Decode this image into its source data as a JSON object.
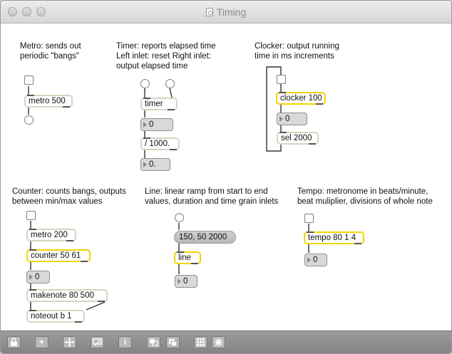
{
  "window": {
    "title": "Timing"
  },
  "comments": {
    "metro": "Metro: sends out\nperiodic \"bangs\"",
    "timer": "Timer: reports elapsed time\nLeft inlet: reset Right inlet:\noutput elapsed time",
    "clocker": "Clocker: output running\ntime in ms increments",
    "counter": "Counter: counts bangs, outputs\nbetween min/max values",
    "line": "Line: linear ramp from start to end\nvalues, duration and time grain inlets",
    "tempo": "Tempo: metronome in beats/minute,\nbeat muliplier, divisions of whole note"
  },
  "objects": {
    "metro1": "metro 500",
    "timer": "timer",
    "divide": "/ 1000.",
    "clocker": "clocker 100",
    "sel": "sel 2000",
    "metro2": "metro 200",
    "counter": "counter 50 61",
    "makenote": "makenote 80 500",
    "noteout": "noteout b 1",
    "line": "line",
    "tempo": "tempo 80 1 4"
  },
  "numbers": {
    "timer_out": "0",
    "divide_out": "0.",
    "clocker_out": "0",
    "counter_out": "0",
    "line_out": "0",
    "tempo_out": "0"
  },
  "messages": {
    "line_msg": "150, 50 2000"
  },
  "colors": {
    "highlight": "#f2d300",
    "object_border": "#d7d5c0"
  },
  "toolbar_icons": [
    "lock-icon",
    "add-icon",
    "move-icon",
    "presentation-icon",
    "inspector-icon",
    "patcher-icon",
    "window-icon",
    "grid-icon",
    "settings-icon"
  ]
}
